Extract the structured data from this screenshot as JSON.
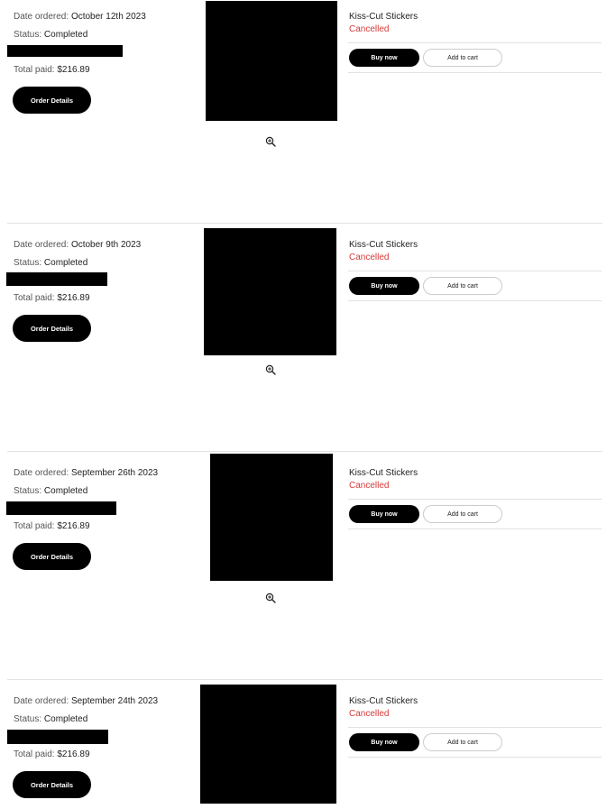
{
  "labels": {
    "date_label": "Date ordered:",
    "status_label": "Status:",
    "total_label": "Total paid:",
    "order_details": "Order Details",
    "buy_now": "Buy now",
    "add_to_cart": "Add to cart"
  },
  "icons": {
    "zoom": "zoom-in-icon"
  },
  "colors": {
    "cancelled": "#d63a3a",
    "primary_button": "#000000"
  },
  "orders": [
    {
      "date": "October 12th 2023",
      "status": "Completed",
      "total": "$216.89",
      "product_title": "Kiss-Cut Stickers",
      "product_status": "Cancelled"
    },
    {
      "date": "October 9th 2023",
      "status": "Completed",
      "total": "$216.89",
      "product_title": "Kiss-Cut Stickers",
      "product_status": "Cancelled"
    },
    {
      "date": "September 26th 2023",
      "status": "Completed",
      "total": "$216.89",
      "product_title": "Kiss-Cut Stickers",
      "product_status": "Cancelled"
    },
    {
      "date": "September 24th 2023",
      "status": "Completed",
      "total": "$216.89",
      "product_title": "Kiss-Cut Stickers",
      "product_status": "Cancelled"
    }
  ]
}
